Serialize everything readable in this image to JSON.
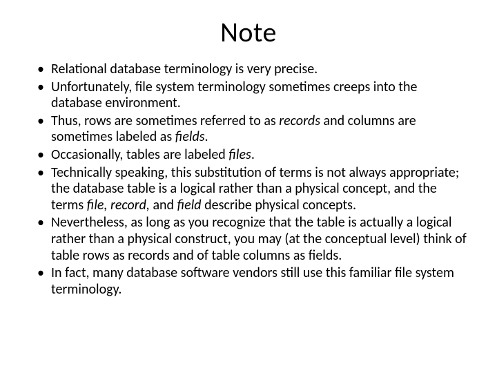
{
  "title": "Note",
  "bullets": [
    {
      "text": "Relational database terminology is very precise."
    },
    {
      "text": "Unfortunately, file system terminology sometimes creeps into the database environment."
    },
    {
      "pre": "Thus, rows are sometimes referred to as ",
      "i1": "records",
      "mid": " and columns are sometimes labeled as ",
      "i2": "fields",
      "post": "."
    },
    {
      "pre": "Occasionally, tables are labeled ",
      "i1": "files",
      "post": "."
    },
    {
      "pre": "Technically speaking, this substitution of terms is not always appropriate; the database table is a logical rather than a physical concept, and the terms ",
      "i1": "file, record,",
      "mid": " and ",
      "i2": "field",
      "post": " describe physical concepts."
    },
    {
      "text": "Nevertheless, as long as you recognize that the table is actually a logical rather than a physical construct, you may (at the conceptual level) think of table rows as records and of table columns as fields."
    },
    {
      "text": "In fact, many database software vendors still use this familiar file system terminology."
    }
  ]
}
